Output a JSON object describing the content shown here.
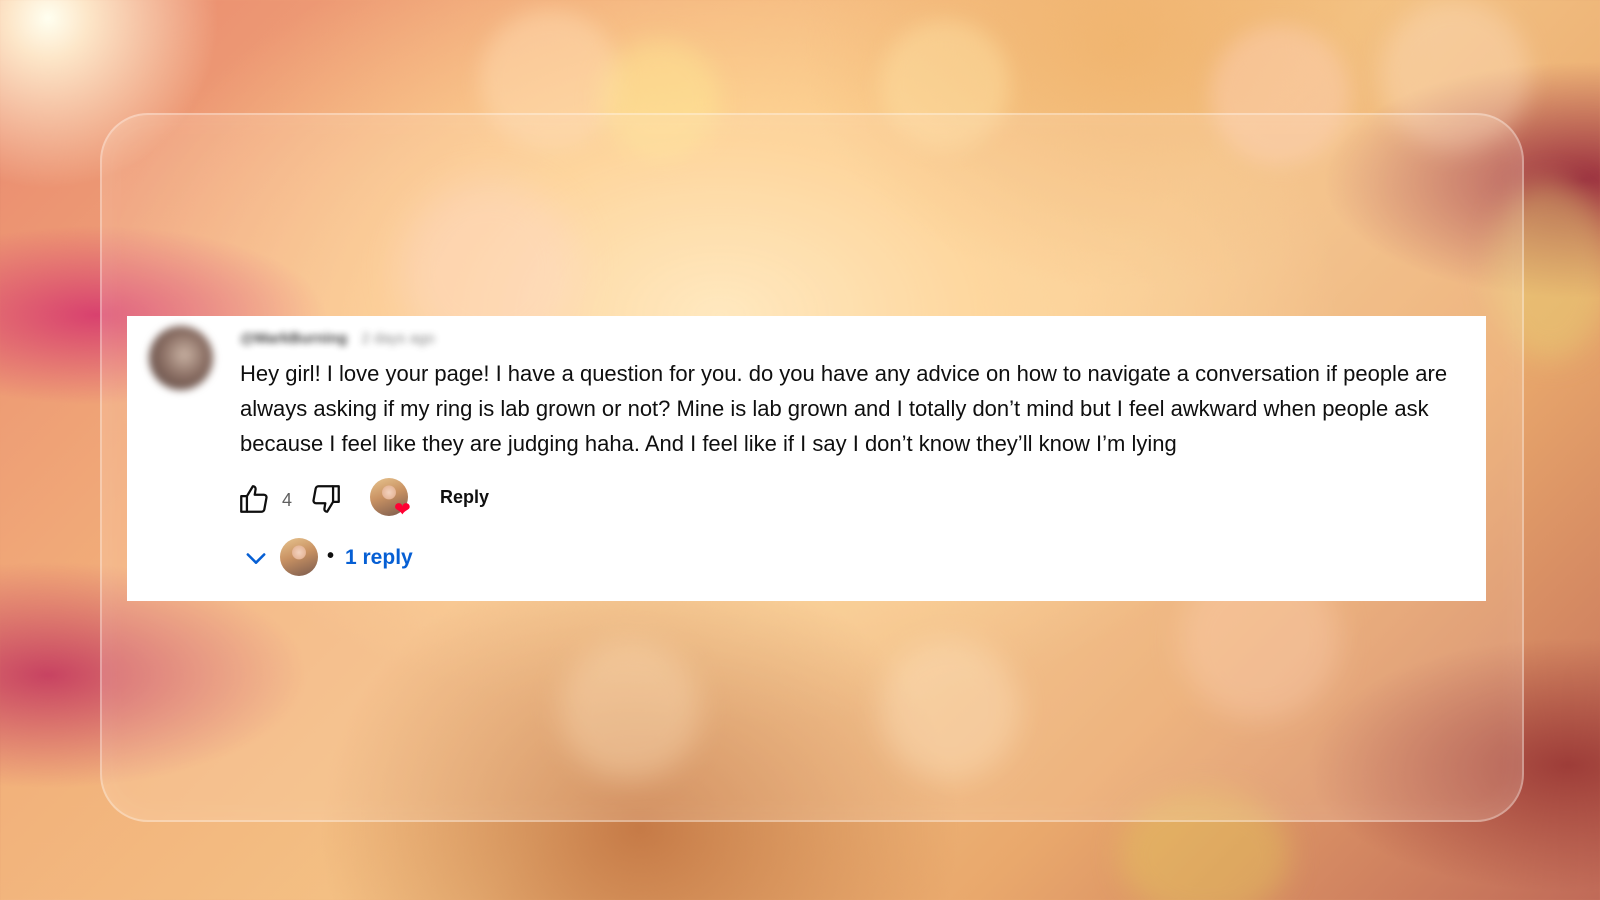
{
  "comment": {
    "author_handle": "@MarkBurning",
    "posted_time": "2 days ago",
    "text": "Hey girl! I love your page! I have a question for you. do you have any advice on how to navigate a conversation if people are always asking if my ring is lab grown or not? Mine is lab grown and I totally don’t mind but I feel awkward when people ask because I feel like they are judging haha. And I feel like if I say I don’t know they’ll know I’m lying",
    "like_count": "4",
    "creator_heart": true,
    "reply_label": "Reply",
    "replies": {
      "separator": "•",
      "count_label": "1 reply"
    }
  },
  "icons": {
    "like": "thumbs-up-icon",
    "dislike": "thumbs-down-icon",
    "heart": "heart-icon",
    "expand": "chevron-down-icon"
  },
  "colors": {
    "panel_background": "#ffffff",
    "text": "#0f0f0f",
    "secondary_text": "#606060",
    "link_blue": "#065fd4",
    "heart_red": "#ff0033"
  }
}
